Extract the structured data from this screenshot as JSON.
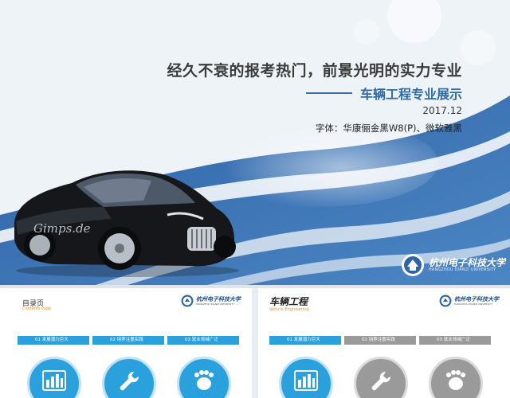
{
  "hero": {
    "title": "经久不衰的报考热门，前景光明的实力专业",
    "subtitle": "车辆工程专业展示",
    "date": "2017.12",
    "fonts_note": "字体：华康俪金黑W8(P)、微软雅黑",
    "car_watermark": "Gimps.de",
    "university": {
      "name_cn": "杭州电子科技大学",
      "name_en": "HANGZHOU DIANZI UNIVERSITY"
    }
  },
  "slide_left": {
    "title": "目录页",
    "subtitle": "Contents Page",
    "logo_cn": "杭州电子科技大学",
    "logo_en": "HANGZHOU DIANZI UNIVERSITY",
    "tabs": [
      "01  发展潜力巨大",
      "02  培养注重实践",
      "03  就业领域广泛"
    ],
    "icons": [
      "bar-chart-icon",
      "wrench-icon",
      "footprint-icon"
    ]
  },
  "slide_right": {
    "title": "车辆工程",
    "subtitle": "Vehicle Engineering",
    "logo_cn": "杭州电子科技大学",
    "logo_en": "HANGZHOU DIANZI UNIVERSITY",
    "tabs": [
      "01  发展潜力巨大",
      "02  培养注重实践",
      "03  就业领域广泛"
    ],
    "icons": [
      "bar-chart-icon",
      "wrench-icon",
      "footprint-icon"
    ]
  },
  "colors": {
    "accent_blue": "#2aa1dc",
    "title_blue": "#2d6aa8",
    "wave_blue": "#3f73b0",
    "inactive_gray": "#9a9a9a"
  }
}
